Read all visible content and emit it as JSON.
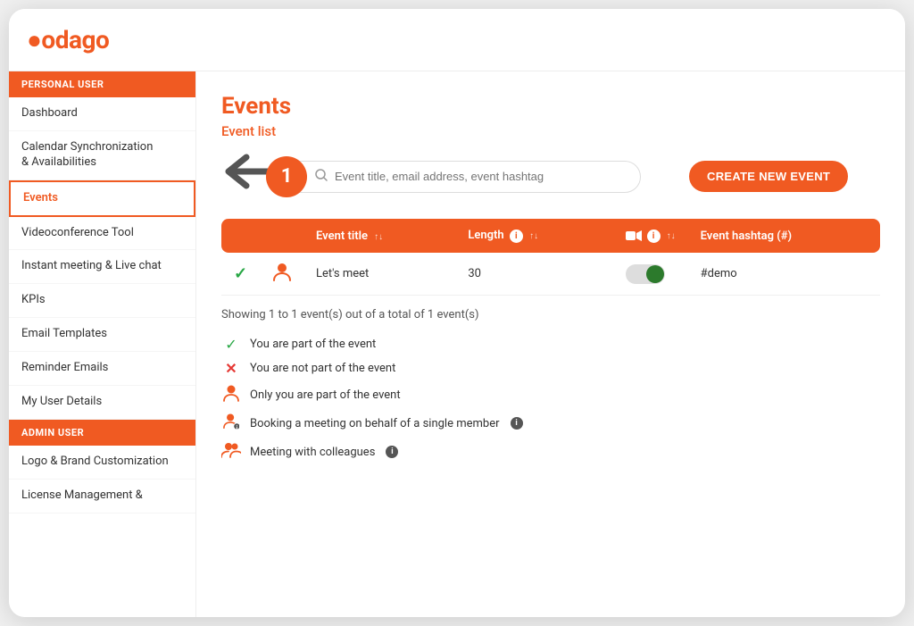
{
  "app": {
    "logo": "odago",
    "logo_prefix": "🔴"
  },
  "sidebar": {
    "personal_user_label": "PERSONAL USER",
    "admin_user_label": "ADMIN USER",
    "personal_items": [
      {
        "label": "Dashboard",
        "active": false
      },
      {
        "label": "Calendar Synchronization & Availabilities",
        "active": false
      },
      {
        "label": "Events",
        "active": true
      },
      {
        "label": "Videoconference Tool",
        "active": false
      },
      {
        "label": "Instant meeting & Live chat",
        "active": false
      },
      {
        "label": "KPIs",
        "active": false
      },
      {
        "label": "Email Templates",
        "active": false
      },
      {
        "label": "Reminder Emails",
        "active": false
      },
      {
        "label": "My User Details",
        "active": false
      }
    ],
    "admin_items": [
      {
        "label": "Logo & Brand Customization",
        "active": false
      },
      {
        "label": "License Management &",
        "active": false
      }
    ]
  },
  "content": {
    "page_title": "Events",
    "event_list_label": "Event list",
    "search_placeholder": "Event title, email address, event hashtag",
    "create_btn_label": "CREATE NEW EVENT",
    "step_number": "1",
    "table": {
      "headers": [
        {
          "key": "status",
          "label": ""
        },
        {
          "key": "icon",
          "label": ""
        },
        {
          "key": "title",
          "label": "Event title"
        },
        {
          "key": "length",
          "label": "Length"
        },
        {
          "key": "video",
          "label": ""
        },
        {
          "key": "hashtag",
          "label": "Event hashtag (#)"
        }
      ],
      "rows": [
        {
          "status_icon": "✓",
          "user_icon": "👤",
          "title": "Let's meet",
          "length": "30",
          "video_enabled": true,
          "hashtag": "#demo"
        }
      ]
    },
    "showing_text": "Showing 1 to 1 event(s) out of a total of 1 event(s)",
    "legend": [
      {
        "icon": "check",
        "text": "You are part of the event"
      },
      {
        "icon": "cross",
        "text": "You are not part of the event"
      },
      {
        "icon": "user-single",
        "text": "Only you are part of the event"
      },
      {
        "icon": "user-booking",
        "text": "Booking a meeting on behalf of a single member"
      },
      {
        "icon": "users-group",
        "text": "Meeting with colleagues"
      }
    ]
  }
}
